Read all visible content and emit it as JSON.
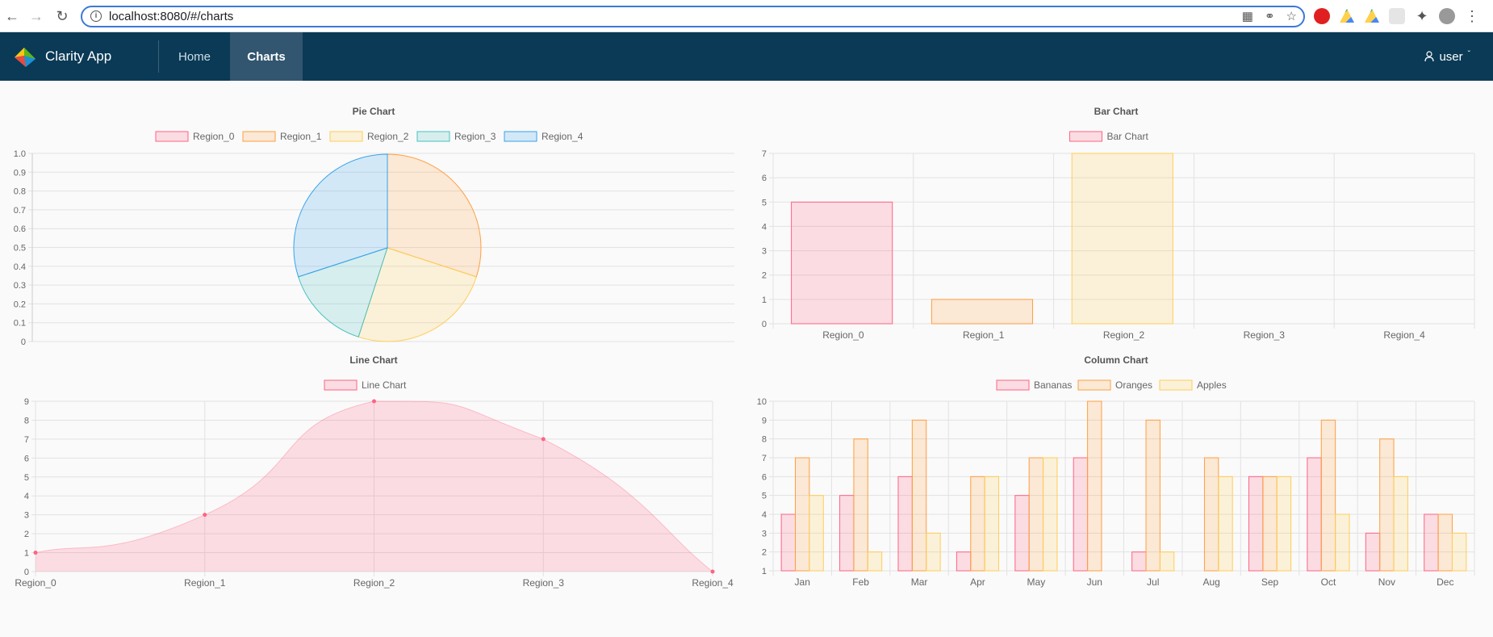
{
  "browser": {
    "url": "localhost:8080/#/charts",
    "back_icon": "arrow-left-icon",
    "forward_icon": "arrow-right-icon",
    "reload_icon": "reload-icon"
  },
  "app": {
    "brand_name": "Clarity App",
    "nav": [
      {
        "label": "Home",
        "active": false
      },
      {
        "label": "Charts",
        "active": true
      }
    ],
    "user_label": "user",
    "colors": {
      "header_bg": "#0a3a56",
      "active_nav": "#325670"
    }
  },
  "chart_data": [
    {
      "type": "pie",
      "title": "Pie Chart",
      "legend": [
        "Region_0",
        "Region_1",
        "Region_2",
        "Region_3",
        "Region_4"
      ],
      "values": [
        0,
        30,
        25,
        15,
        30
      ],
      "yticks": [
        "1.0",
        "0.9",
        "0.8",
        "0.7",
        "0.6",
        "0.5",
        "0.4",
        "0.3",
        "0.2",
        "0.1",
        "0"
      ],
      "ylim": [
        0,
        1
      ],
      "grid": true,
      "legend_position": "top"
    },
    {
      "type": "bar",
      "title": "Bar Chart",
      "legend": [
        "Bar Chart"
      ],
      "categories": [
        "Region_0",
        "Region_1",
        "Region_2",
        "Region_3",
        "Region_4"
      ],
      "values": [
        5,
        1,
        7,
        0,
        0
      ],
      "yticks": [
        "7",
        "6",
        "5",
        "4",
        "3",
        "2",
        "1",
        "0"
      ],
      "ylim": [
        0,
        7
      ],
      "grid": true,
      "legend_position": "top"
    },
    {
      "type": "area",
      "title": "Line Chart",
      "legend": [
        "Line Chart"
      ],
      "categories": [
        "Region_0",
        "Region_1",
        "Region_2",
        "Region_3",
        "Region_4"
      ],
      "values": [
        1,
        3,
        9,
        7,
        0
      ],
      "yticks": [
        "9",
        "8",
        "7",
        "6",
        "5",
        "4",
        "3",
        "2",
        "1",
        "0"
      ],
      "ylim": [
        0,
        9
      ],
      "grid": true,
      "legend_position": "top"
    },
    {
      "type": "bar",
      "title": "Column Chart",
      "categories": [
        "Jan",
        "Feb",
        "Mar",
        "Apr",
        "May",
        "Jun",
        "Jul",
        "Aug",
        "Sep",
        "Oct",
        "Nov",
        "Dec"
      ],
      "series": [
        {
          "name": "Bananas",
          "values": [
            4,
            5,
            6,
            2,
            5,
            7,
            2,
            1,
            6,
            7,
            3,
            4
          ]
        },
        {
          "name": "Oranges",
          "values": [
            7,
            8,
            9,
            6,
            7,
            10,
            9,
            7,
            6,
            9,
            8,
            4
          ]
        },
        {
          "name": "Apples",
          "values": [
            5,
            2,
            3,
            6,
            7,
            1,
            2,
            6,
            6,
            4,
            6,
            3
          ]
        }
      ],
      "yticks": [
        "10",
        "9",
        "8",
        "7",
        "6",
        "5",
        "4",
        "3",
        "2",
        "1"
      ],
      "ylim": [
        1,
        10
      ],
      "grid": true,
      "legend_position": "top"
    }
  ],
  "palette": {
    "fills": [
      "rgba(255,99,132,0.2)",
      "rgba(255,159,64,0.2)",
      "rgba(255,205,86,0.2)",
      "rgba(75,192,192,0.2)",
      "rgba(54,162,235,0.2)"
    ],
    "strokes": [
      "#ff6384",
      "#ff9f40",
      "#ffcd56",
      "#4bc0c0",
      "#36a2eb"
    ]
  }
}
